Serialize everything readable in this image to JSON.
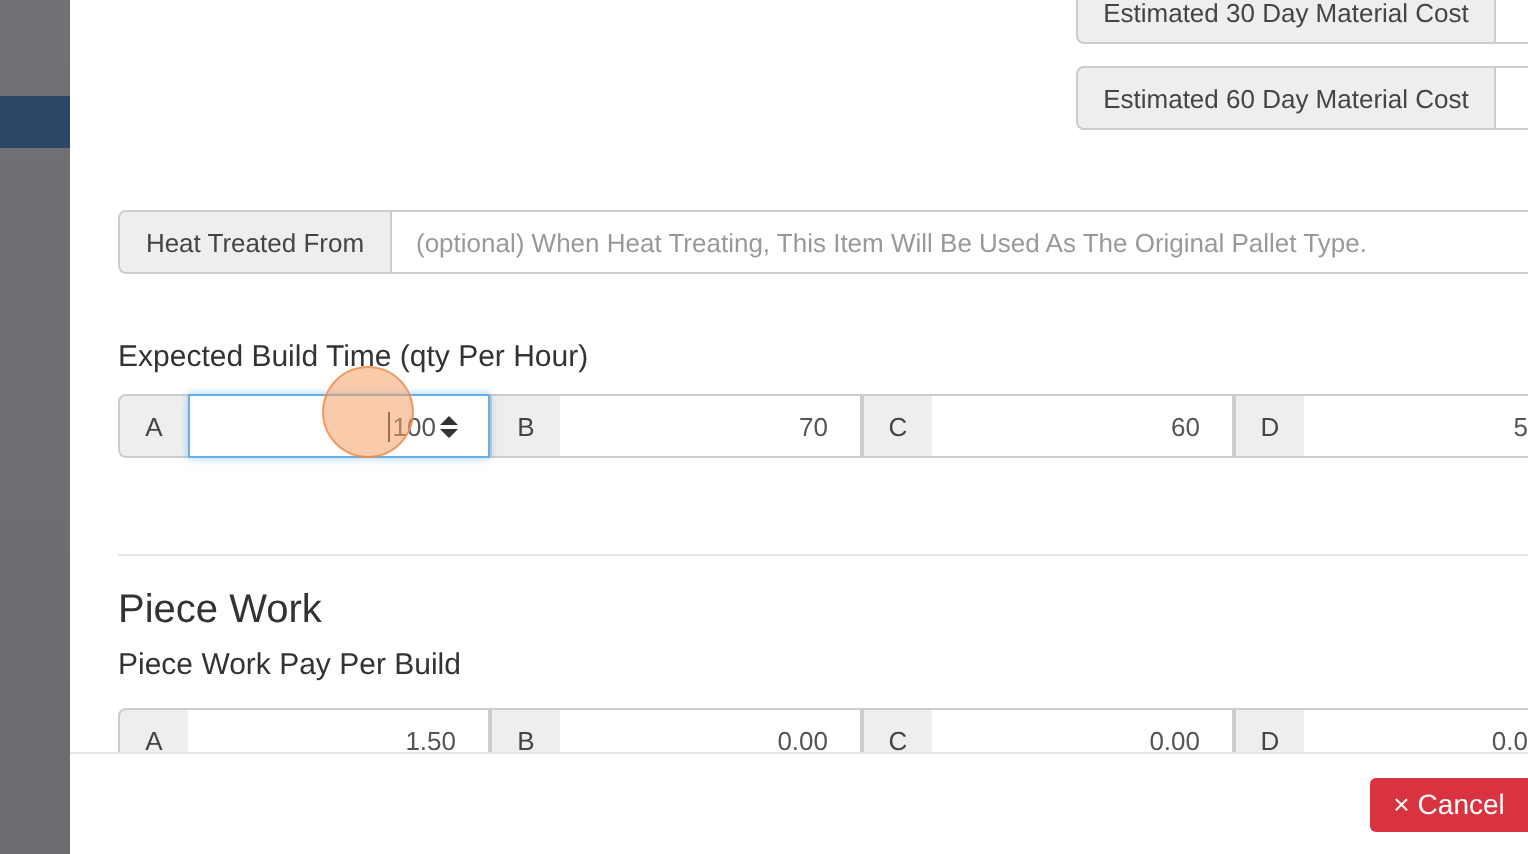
{
  "cost_fields": [
    {
      "label": "Estimated 30 Day Material Cost"
    },
    {
      "label": "Estimated 60 Day Material Cost"
    }
  ],
  "heat_treated": {
    "label": "Heat Treated From",
    "placeholder": "(optional) When Heat Treating, This Item Will Be Used As The Original Pallet Type."
  },
  "build_time": {
    "label": "Expected Build Time (qty Per Hour)",
    "fields": [
      {
        "letter": "A",
        "value": "100",
        "focused": true
      },
      {
        "letter": "B",
        "value": "70",
        "focused": false
      },
      {
        "letter": "C",
        "value": "60",
        "focused": false
      },
      {
        "letter": "D",
        "value": "5",
        "focused": false
      }
    ]
  },
  "piece_work": {
    "heading": "Piece Work",
    "label": "Piece Work Pay Per Build",
    "fields": [
      {
        "letter": "A",
        "value": "1.50"
      },
      {
        "letter": "B",
        "value": "0.00"
      },
      {
        "letter": "C",
        "value": "0.00"
      },
      {
        "letter": "D",
        "value": "0.0"
      }
    ]
  },
  "footer": {
    "cancel_button": {
      "icon": "×",
      "label": "Cancel"
    }
  }
}
